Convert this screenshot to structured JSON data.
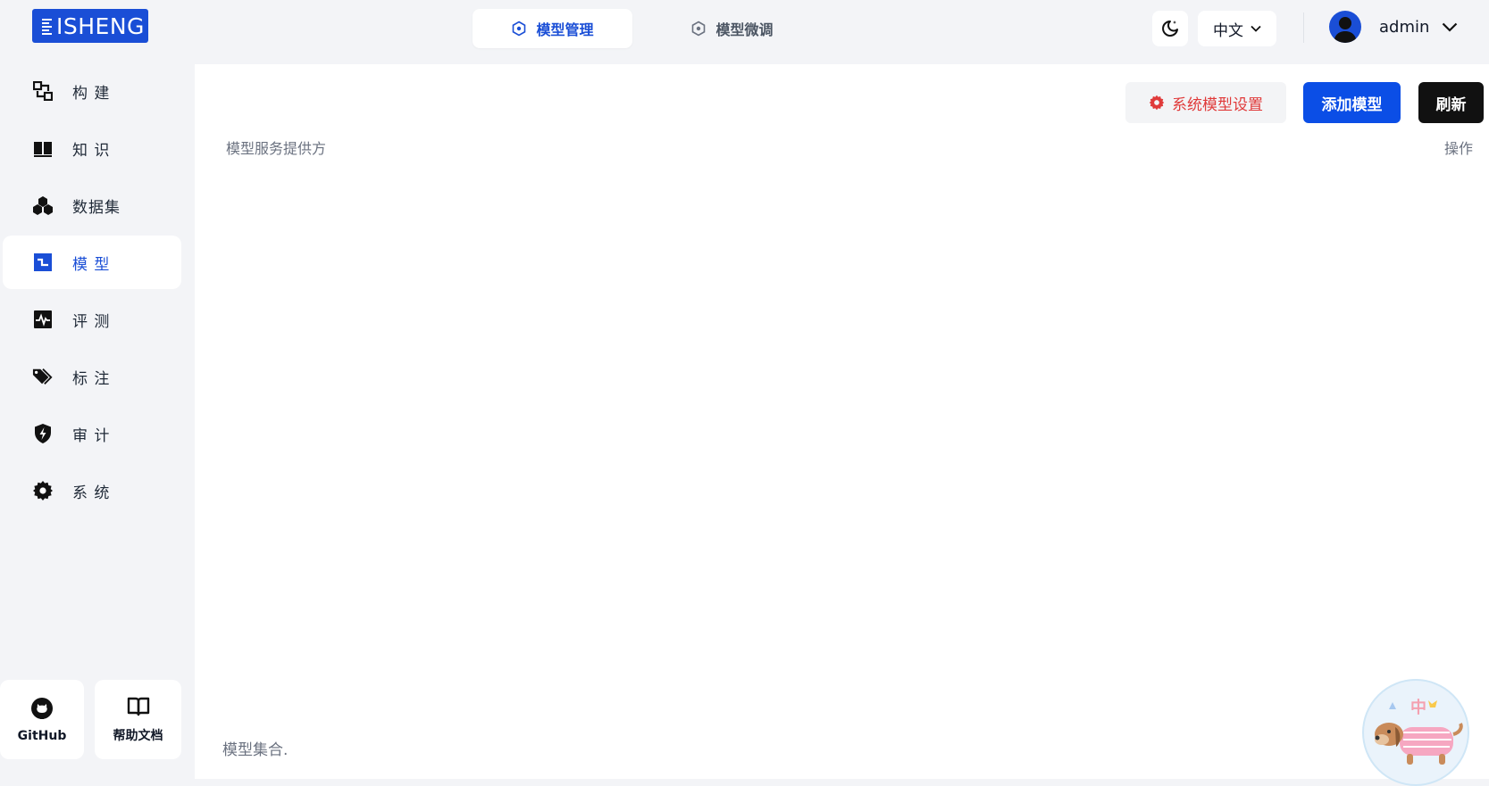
{
  "brand": {
    "name": "ISHENG"
  },
  "top_tabs": [
    {
      "label": "模型管理",
      "active": true
    },
    {
      "label": "模型微调",
      "active": false
    }
  ],
  "header": {
    "language": "中文",
    "username": "admin"
  },
  "sidebar": {
    "items": [
      {
        "label": "构  建",
        "icon": "build-icon",
        "active": false
      },
      {
        "label": "知  识",
        "icon": "book-icon",
        "active": false
      },
      {
        "label": "数据集",
        "icon": "dataset-cubes-icon",
        "active": false
      },
      {
        "label": "模  型",
        "icon": "model-icon",
        "active": true
      },
      {
        "label": "评  测",
        "icon": "pulse-icon",
        "active": false
      },
      {
        "label": "标  注",
        "icon": "tags-icon",
        "active": false
      },
      {
        "label": "审  计",
        "icon": "shield-bolt-icon",
        "active": false
      },
      {
        "label": "系  统",
        "icon": "gear-icon",
        "active": false
      }
    ],
    "bottom": {
      "github_label": "GitHub",
      "help_label": "帮助文档"
    }
  },
  "toolbar": {
    "system_model_settings": "系统模型设置",
    "add_model": "添加模型",
    "refresh": "刷新"
  },
  "table": {
    "columns": [
      "模型服务提供方",
      "操作"
    ]
  },
  "footer_note": "模型集合.",
  "mascot": {
    "badge": "中"
  },
  "colors": {
    "primary": "#1a4ed6",
    "danger": "#e03a3a",
    "dark": "#111111",
    "background": "#f3f4f7"
  }
}
